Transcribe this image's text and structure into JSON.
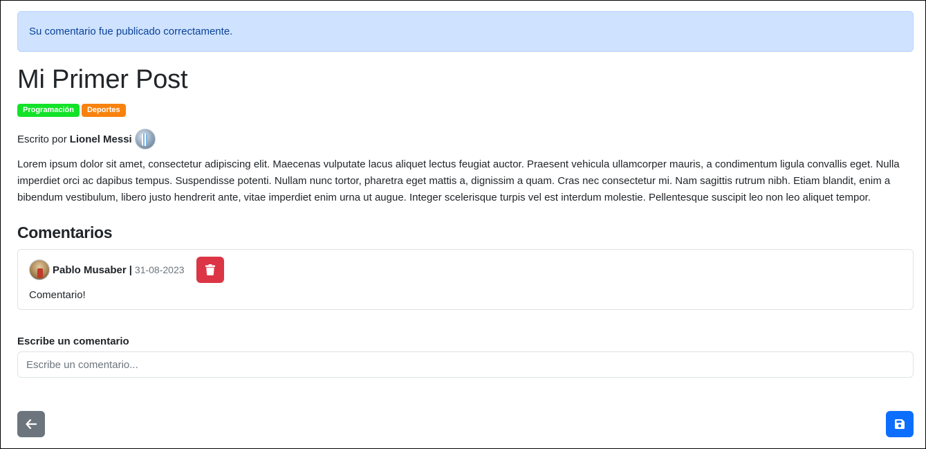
{
  "alert": {
    "message": "Su comentario fue publicado correctamente."
  },
  "post": {
    "title": "Mi Primer Post",
    "tags": [
      {
        "label": "Programación",
        "color": "#13e229"
      },
      {
        "label": "Deportes",
        "color": "#f8820e"
      }
    ],
    "author_prefix": "Escrito por",
    "author_name": "Lionel Messi",
    "author_avatar_icon": "user-avatar-icon",
    "body": "Lorem ipsum dolor sit amet, consectetur adipiscing elit. Maecenas vulputate lacus aliquet lectus feugiat auctor. Praesent vehicula ullamcorper mauris, a condimentum ligula convallis eget. Nulla imperdiet orci ac dapibus tempus. Suspendisse potenti. Nullam nunc tortor, pharetra eget mattis a, dignissim a quam. Cras nec consectetur mi. Nam sagittis rutrum nibh. Etiam blandit, enim a bibendum vestibulum, libero justo hendrerit ante, vitae imperdiet enim urna ut augue. Integer scelerisque turpis vel est interdum molestie. Pellentesque suscipit leo non leo aliquet tempor."
  },
  "comments_section": {
    "heading": "Comentarios",
    "items": [
      {
        "author": "Pablo Musaber",
        "separator": "|",
        "date": "31-08-2023",
        "text": "Comentario!",
        "delete_icon": "trash-icon"
      }
    ]
  },
  "comment_form": {
    "label": "Escribe un comentario",
    "placeholder": "Escribe un comentario...",
    "value": ""
  },
  "actions": {
    "back_icon": "arrow-left-icon",
    "save_icon": "floppy-disk-icon"
  },
  "colors": {
    "alert_bg": "#cfe2ff",
    "alert_text": "#084298",
    "danger": "#dc3545",
    "secondary": "#6c757d",
    "primary": "#0d6efd"
  }
}
